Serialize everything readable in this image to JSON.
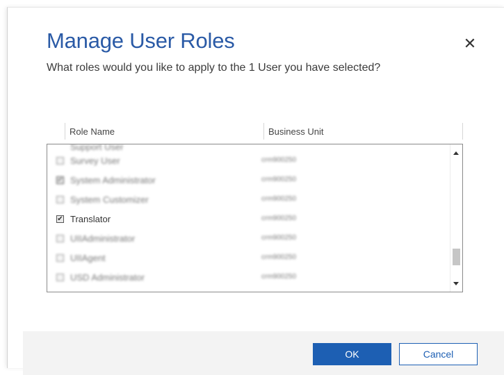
{
  "dialog": {
    "title": "Manage User Roles",
    "subtitle": "What roles would you like to apply to the 1 User you have selected?",
    "close_icon": "close-icon"
  },
  "grid": {
    "columns": [
      "Role Name",
      "Business Unit"
    ],
    "rows": [
      {
        "name": "Survey User",
        "business_unit": "crm900250",
        "checked": false,
        "blurred": true
      },
      {
        "name": "System Administrator",
        "business_unit": "crm900250",
        "checked": true,
        "blurred": true
      },
      {
        "name": "System Customizer",
        "business_unit": "crm900250",
        "checked": false,
        "blurred": true
      },
      {
        "name": "Translator",
        "business_unit": "crm900250",
        "checked": true,
        "blurred": false
      },
      {
        "name": "UIIAdministrator",
        "business_unit": "crm900250",
        "checked": false,
        "blurred": true
      },
      {
        "name": "UIIAgent",
        "business_unit": "crm900250",
        "checked": false,
        "blurred": true
      },
      {
        "name": "USD Administrator",
        "business_unit": "crm900250",
        "checked": false,
        "blurred": true
      }
    ]
  },
  "footer": {
    "ok_label": "OK",
    "cancel_label": "Cancel"
  },
  "colors": {
    "title": "#2a5aa6",
    "primary_button": "#1d5fb3",
    "footer_bg": "#f3f3f3"
  }
}
